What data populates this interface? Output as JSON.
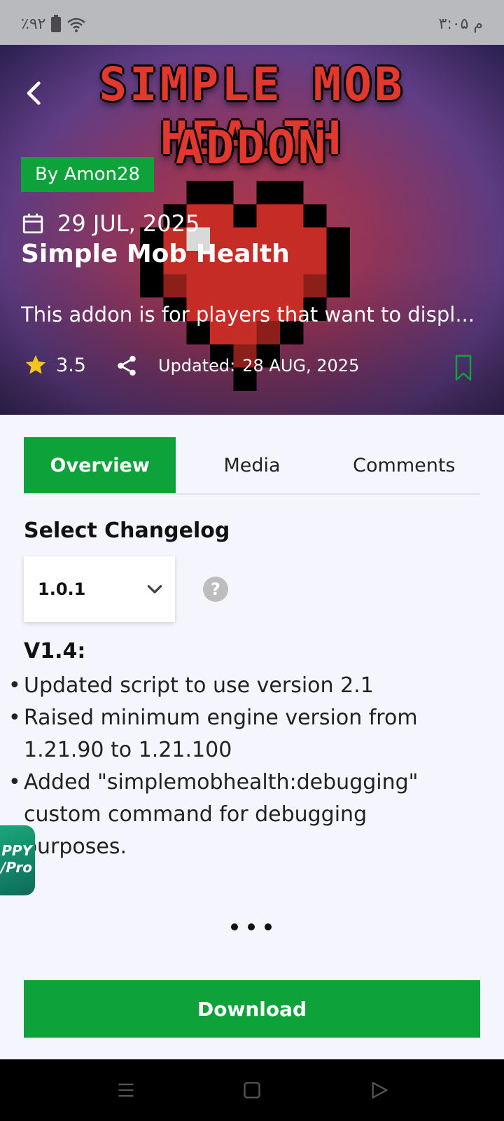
{
  "status": {
    "battery": "٪۹۲",
    "time": "۳:۰۵ م"
  },
  "hero": {
    "art_title_line1": "SIMPLE MOB HEALTH",
    "art_title_line2": "ADDON",
    "author": "By Amon28",
    "date": "29 JUL, 2025",
    "title": "Simple Mob Health",
    "description": "This addon is for players that want to displ...",
    "rating": "3.5",
    "updated_label": "Updated:",
    "updated_date": "28 AUG, 2025"
  },
  "tabs": [
    {
      "label": "Overview",
      "active": true
    },
    {
      "label": "Media",
      "active": false
    },
    {
      "label": "Comments",
      "active": false
    }
  ],
  "changelog": {
    "section_title": "Select Changelog",
    "selected_version": "1.0.1",
    "help_symbol": "?",
    "version_heading": "V1.4:",
    "items": [
      "Updated script to use version 2.1",
      "Raised minimum engine version from 1.21.90 to 1.21.100",
      "Added \"simplemobhealth:debugging\" custom command for debugging purposes."
    ]
  },
  "promo": {
    "line1": "PPY",
    "line2": "/Pro"
  },
  "download_label": "Download",
  "colors": {
    "accent": "#0ea33a",
    "background": "#f4f5fd",
    "star": "#f5c518"
  },
  "icons": [
    "back-arrow-icon",
    "calendar-icon",
    "star-icon",
    "share-icon",
    "bookmark-icon",
    "chevron-down-icon",
    "help-icon",
    "menu-icon",
    "home-icon",
    "back-triangle-icon"
  ]
}
